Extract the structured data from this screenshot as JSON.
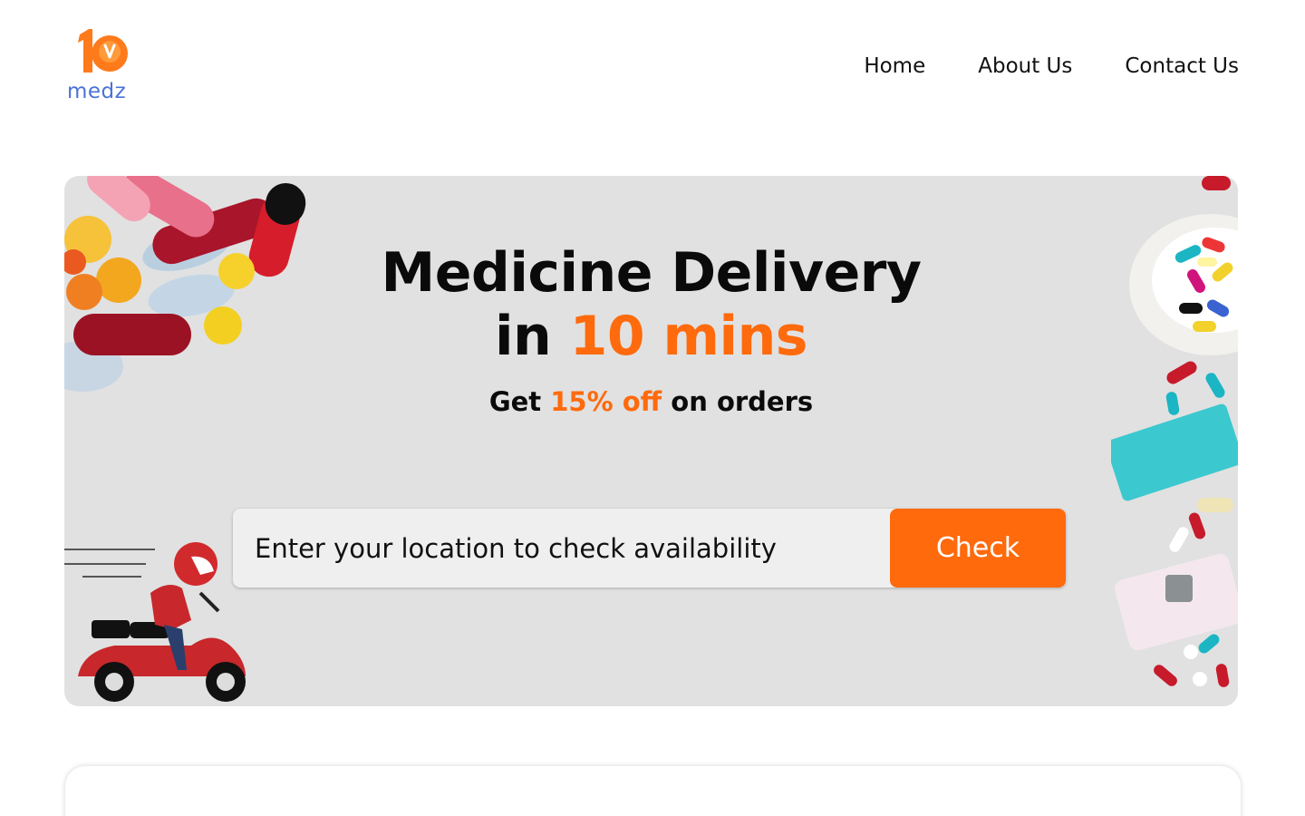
{
  "brand": {
    "name": "medz",
    "mark_text": "10",
    "accent": "#ff6a0d",
    "text_color": "#4a72d6"
  },
  "nav": {
    "items": [
      {
        "label": "Home"
      },
      {
        "label": "About Us"
      },
      {
        "label": "Contact Us"
      }
    ]
  },
  "hero": {
    "headline_line1": "Medicine Delivery",
    "headline_line2_prefix": "in ",
    "headline_line2_highlight": "10 mins",
    "offer_prefix": "Get ",
    "offer_highlight": "15% off",
    "offer_suffix": " on orders",
    "background": "#e1e1e1",
    "highlight_color": "#ff6a0d"
  },
  "search": {
    "placeholder": "Enter your location to check availability",
    "button_label": "Check"
  },
  "icons": [
    "logo-clock-icon",
    "pills-decoration",
    "pill-organizer-decoration",
    "delivery-scooter-illustration"
  ]
}
